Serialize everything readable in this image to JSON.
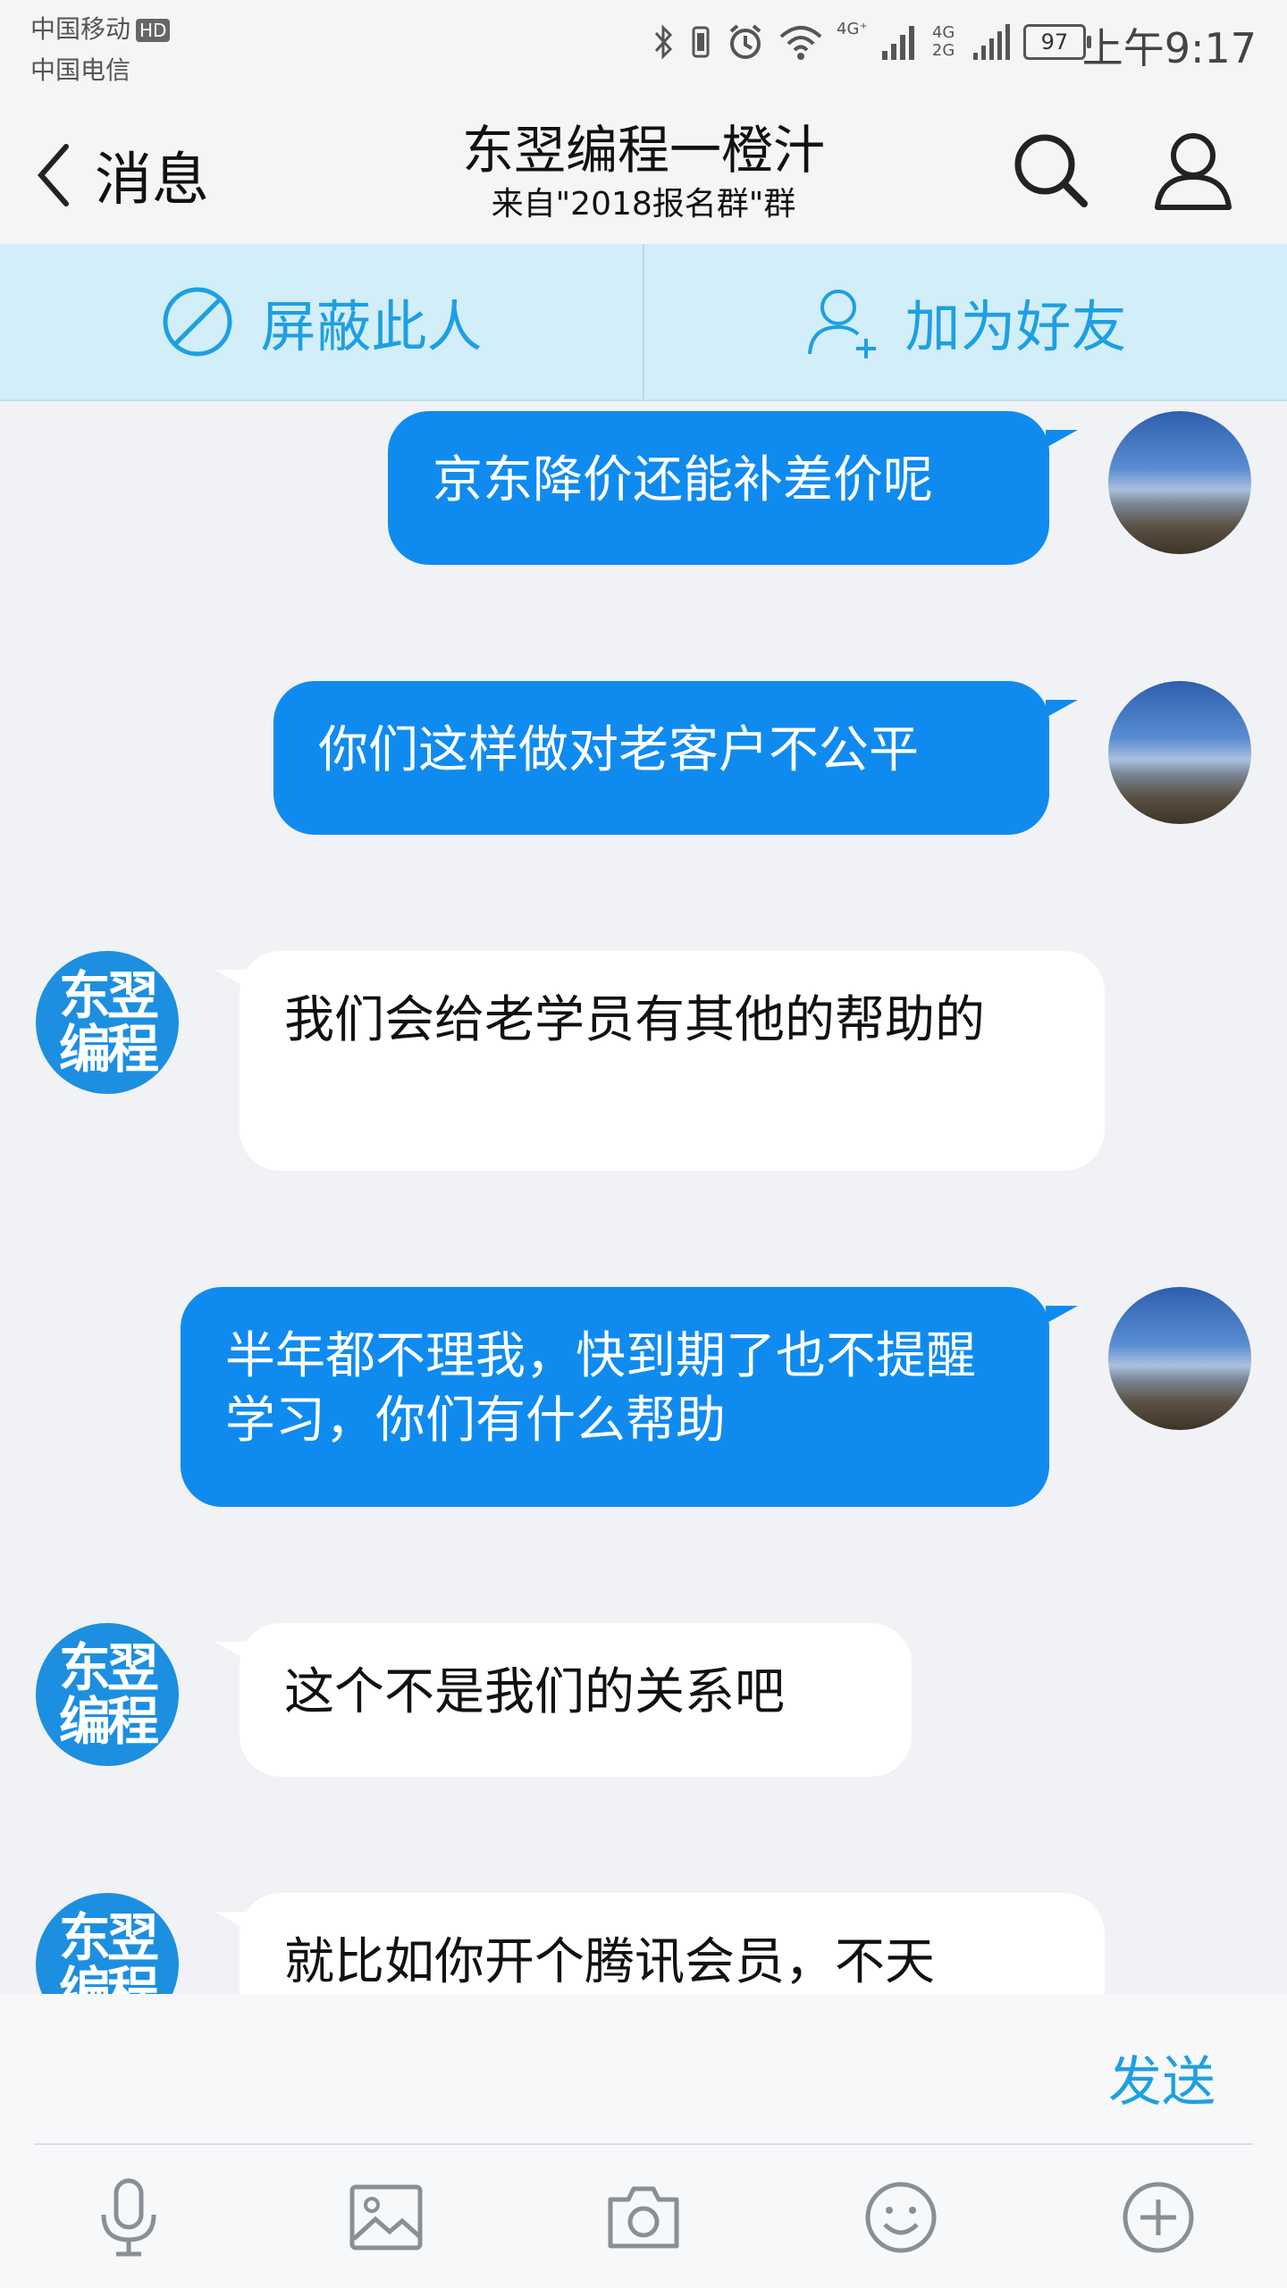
{
  "status_bar": {
    "carrier_1": "中国移动",
    "carrier_1_badge": "HD",
    "carrier_2": "中国电信",
    "network_1": "4G⁺",
    "network_2": "4G 2G",
    "battery": "97",
    "time": "上午9:17"
  },
  "header": {
    "back_label": "消息",
    "title": "东翌编程一橙汁",
    "subtitle": "来自\"2018报名群\"群",
    "icons": [
      "search-icon",
      "profile-icon"
    ]
  },
  "actions": {
    "block_label": "屏蔽此人",
    "add_friend_label": "加为好友"
  },
  "brand_avatar": {
    "line1": "东翌",
    "line2": "编程"
  },
  "messages": [
    {
      "side": "out",
      "text": "京东降价还能补差价呢"
    },
    {
      "side": "out",
      "text": "你们这样做对老客户不公平"
    },
    {
      "side": "in",
      "text": "我们会给老学员有其他的帮助的"
    },
    {
      "side": "out",
      "text": "半年都不理我，快到期了也不提醒学习，你们有什么帮助"
    },
    {
      "side": "in",
      "text": "这个不是我们的关系吧"
    },
    {
      "side": "in",
      "text": "就比如你开个腾讯会员，不天"
    }
  ],
  "composer": {
    "send_label": "发送",
    "tools": [
      "microphone-icon",
      "image-icon",
      "camera-icon",
      "emoji-icon",
      "plus-icon"
    ]
  },
  "colors": {
    "accent": "#1e9fe3",
    "outgoing_bubble": "#0f8bf0",
    "action_bar": "#d2eef8",
    "chat_bg": "#f1f2f5"
  }
}
